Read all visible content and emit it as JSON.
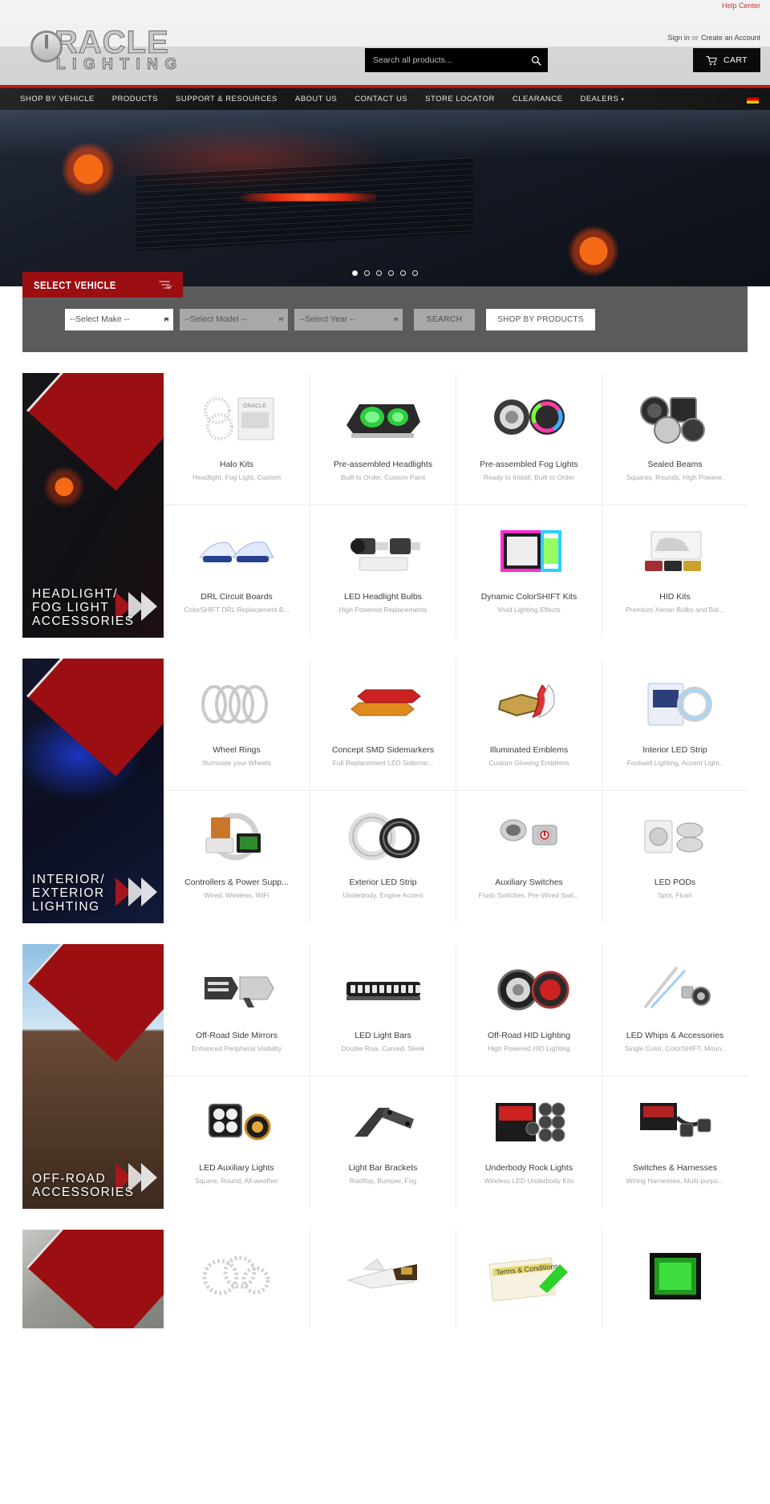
{
  "topbar": {
    "help_center": "Help Center"
  },
  "header": {
    "logo_word": "RACLE",
    "logo_sub": "LIGHTING",
    "signin": "Sign in",
    "or": "or",
    "create_account": "Create an Account",
    "search_placeholder": "Search all products...",
    "search_value": "",
    "cart_label": "CART"
  },
  "nav": {
    "items": [
      {
        "label": "SHOP BY VEHICLE",
        "caret": false
      },
      {
        "label": "PRODUCTS",
        "caret": false
      },
      {
        "label": "SUPPORT & RESOURCES",
        "caret": false
      },
      {
        "label": "ABOUT US",
        "caret": false
      },
      {
        "label": "CONTACT US",
        "caret": false
      },
      {
        "label": "STORE LOCATOR",
        "caret": false
      },
      {
        "label": "CLEARANCE",
        "caret": false
      },
      {
        "label": "DEALERS",
        "caret": true
      }
    ],
    "caret_glyph": "▾"
  },
  "hero": {
    "slides": 6,
    "active_slide": 1
  },
  "select_vehicle": {
    "tab_label": "SELECT VEHICLE",
    "make_value": "--Select Make --",
    "model_value": "--Select Model --",
    "year_value": "--Select Year --",
    "search_label": "SEARCH",
    "shop_products_label": "SHOP BY PRODUCTS"
  },
  "blocks": [
    {
      "banner_title": "HEADLIGHT/ FOG LIGHT ACCESSORIES",
      "items": [
        {
          "title": "Halo Kits",
          "sub": "Headlight, Fog Light, Custom",
          "icon": "halo-ring-kit-thumb"
        },
        {
          "title": "Pre-assembled Headlights",
          "sub": "Built to Order, Custom Paint",
          "icon": "green-headlight-thumb"
        },
        {
          "title": "Pre-assembled Fog Lights",
          "sub": "Ready to Install, Built to Order",
          "icon": "rgb-fog-light-thumb"
        },
        {
          "title": "Sealed Beams",
          "sub": "Squares, Rounds, High Powere.",
          "icon": "sealed-beam-thumb"
        },
        {
          "title": "DRL Circuit Boards",
          "sub": "ColorSHIFT DRL Replacement B...",
          "icon": "drl-board-thumb"
        },
        {
          "title": "LED Headlight Bulbs",
          "sub": "High Powered Replacements",
          "icon": "led-bulb-thumb"
        },
        {
          "title": "Dynamic ColorSHIFT Kits",
          "sub": "Vivid Lighting Effects",
          "icon": "colorshift-kit-thumb"
        },
        {
          "title": "HID Kits",
          "sub": "Premium Xenon Bulbs and Bal...",
          "icon": "hid-kit-thumb"
        }
      ]
    },
    {
      "banner_title": "INTERIOR/ EXTERIOR LIGHTING",
      "items": [
        {
          "title": "Wheel Rings",
          "sub": "Illuminate your Wheels",
          "icon": "wheel-rings-thumb"
        },
        {
          "title": "Concept SMD Sidemarkers",
          "sub": "Full Replacement LED Sidemar...",
          "icon": "sidemarker-thumb"
        },
        {
          "title": "Illuminated Emblems",
          "sub": "Custom Glowing Emblems",
          "icon": "emblem-thumb"
        },
        {
          "title": "Interior LED Strip",
          "sub": "Footwell Lighting, Accent Light..",
          "icon": "interior-strip-thumb"
        },
        {
          "title": "Controllers & Power Supp...",
          "sub": "Wired, Wireless, WiFi",
          "icon": "controller-thumb"
        },
        {
          "title": "Exterior LED Strip",
          "sub": "Underbody, Engine Accent",
          "icon": "exterior-strip-thumb"
        },
        {
          "title": "Auxiliary Switches",
          "sub": "Flush Switches, Pre-Wired Swit...",
          "icon": "switch-thumb"
        },
        {
          "title": "LED PODs",
          "sub": "Spot, Flush",
          "icon": "led-pod-thumb"
        }
      ]
    },
    {
      "banner_title": "OFF-ROAD ACCESSORIES",
      "items": [
        {
          "title": "Off-Road Side Mirrors",
          "sub": "Enhanced Peripheral Visibility",
          "icon": "side-mirror-thumb"
        },
        {
          "title": "LED Light Bars",
          "sub": "Double Row, Curved, Sleek",
          "icon": "light-bar-thumb"
        },
        {
          "title": "Off-Road HID Lighting",
          "sub": "High Powered HID Lighting",
          "icon": "offroad-hid-thumb"
        },
        {
          "title": "LED Whips & Accessories",
          "sub": "Single Color, ColorSHIFT, Moun..",
          "icon": "led-whip-thumb"
        },
        {
          "title": "LED Auxiliary Lights",
          "sub": "Square, Round, All-weather",
          "icon": "aux-light-thumb"
        },
        {
          "title": "Light Bar Brackets",
          "sub": "Rooftop, Bumper, Fog",
          "icon": "bracket-thumb"
        },
        {
          "title": "Underbody Rock Lights",
          "sub": "Wireless LED Underbody Kits",
          "icon": "rock-light-thumb"
        },
        {
          "title": "Switches & Harnesses",
          "sub": "Wiring Harnesses, Multi-purpo...",
          "icon": "harness-thumb"
        }
      ]
    },
    {
      "banner_title": "",
      "items": [
        {
          "title": "",
          "sub": "",
          "icon": "halo-rings-thumb"
        },
        {
          "title": "",
          "sub": "",
          "icon": "ups-plane-thumb"
        },
        {
          "title": "",
          "sub": "",
          "icon": "terms-conditions-thumb"
        },
        {
          "title": "",
          "sub": "",
          "icon": "green-led-thumb"
        }
      ]
    }
  ],
  "colors": {
    "brand_red": "#9b0f13",
    "nav_black": "#1b1b1b",
    "accent_red_bar": "#d62222",
    "gray_panel": "#5b5b5b"
  }
}
